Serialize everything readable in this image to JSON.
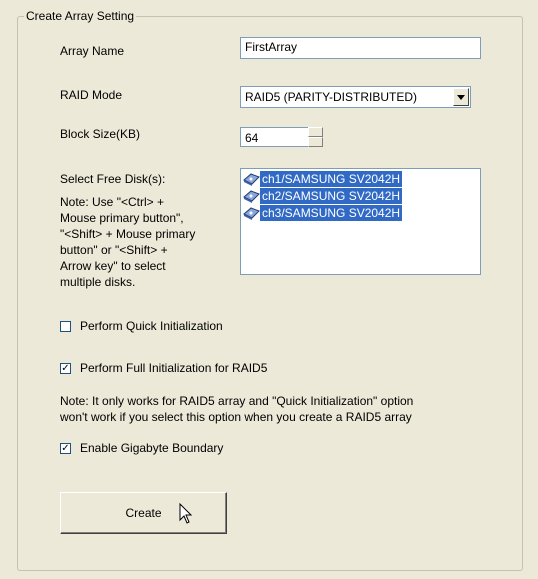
{
  "group": {
    "title": "Create Array Setting"
  },
  "array_name": {
    "label": "Array Name",
    "value": "FirstArray"
  },
  "raid_mode": {
    "label": "RAID Mode",
    "selected": "RAID5 (PARITY-DISTRIBUTED)"
  },
  "block_size": {
    "label": "Block Size(KB)",
    "value": "64"
  },
  "free_disks": {
    "label": "Select Free Disk(s):",
    "items": [
      "ch1/SAMSUNG SV2042H",
      "ch2/SAMSUNG SV2042H",
      "ch3/SAMSUNG SV2042H"
    ]
  },
  "disk_note": {
    "lines": [
      "Note: Use \"<Ctrl> +",
      "Mouse primary button\",",
      "\"<Shift> + Mouse primary",
      "button\" or \"<Shift> +",
      "Arrow key\" to select",
      "multiple disks."
    ]
  },
  "quick_init": {
    "label": "Perform Quick Initialization",
    "checked": false
  },
  "full_init": {
    "label": "Perform Full Initialization for RAID5",
    "checked": true
  },
  "raid5_note": {
    "line1": "Note: It only works for RAID5 array and \"Quick Initialization\" option",
    "line2": "won't work if you select this option when you create a RAID5 array"
  },
  "gigabyte_boundary": {
    "label": "Enable Gigabyte Boundary",
    "checked": true
  },
  "create_button": {
    "label": "Create"
  },
  "colors": {
    "selection": "#316ac5",
    "background": "#ece9d8",
    "field_border": "#7f9db9"
  },
  "icons": {
    "disk": "disk-drive-icon",
    "cursor": "mouse-pointer-icon"
  }
}
